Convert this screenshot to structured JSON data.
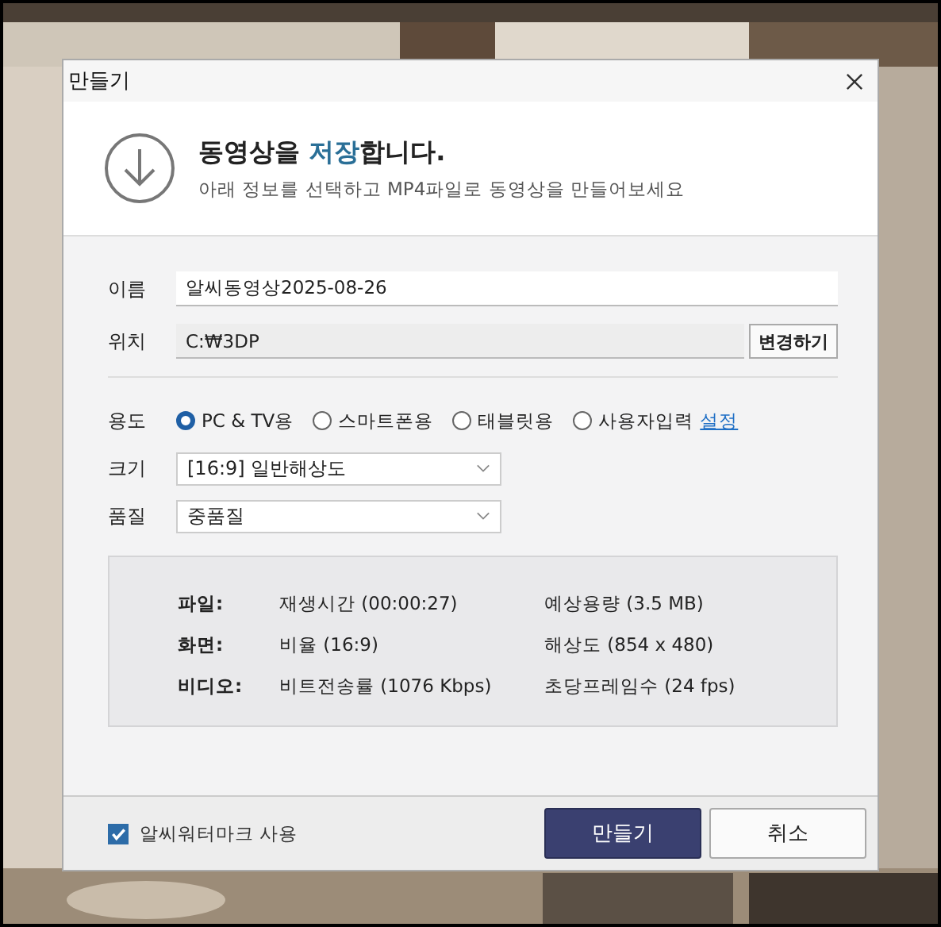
{
  "window": {
    "title": "만들기"
  },
  "header": {
    "title_before": "동영상을 ",
    "title_highlight": "저장",
    "title_after": "합니다.",
    "subtitle": "아래 정보를 선택하고 MP4파일로 동영상을 만들어보세요"
  },
  "name": {
    "label": "이름",
    "value": "알씨동영상2025-08-26"
  },
  "location": {
    "label": "위치",
    "value": "C:₩3DP",
    "button": "변경하기"
  },
  "purpose": {
    "label": "용도",
    "options": [
      {
        "label": "PC & TV용",
        "selected": true
      },
      {
        "label": "스마트폰용",
        "selected": false
      },
      {
        "label": "태블릿용",
        "selected": false
      },
      {
        "label": "사용자입력",
        "selected": false
      }
    ],
    "link": "설정"
  },
  "size": {
    "label": "크기",
    "value": "[16:9] 일반해상도"
  },
  "quality": {
    "label": "품질",
    "value": "중품질"
  },
  "info": [
    {
      "label": "파일:",
      "items": [
        "재생시간 (00:00:27)",
        "예상용량 (3.5 MB)"
      ]
    },
    {
      "label": "화면:",
      "items": [
        "비율 (16:9)",
        "해상도 (854 x 480)"
      ]
    },
    {
      "label": "비디오:",
      "items": [
        "비트전송률 (1076 Kbps)",
        "초당프레임수 (24 fps)"
      ]
    }
  ],
  "watermark": {
    "label": "알씨워터마크 사용",
    "checked": true
  },
  "buttons": [
    {
      "label": "만들기",
      "kind": "primary"
    },
    {
      "label": "취소",
      "kind": "secondary"
    }
  ]
}
